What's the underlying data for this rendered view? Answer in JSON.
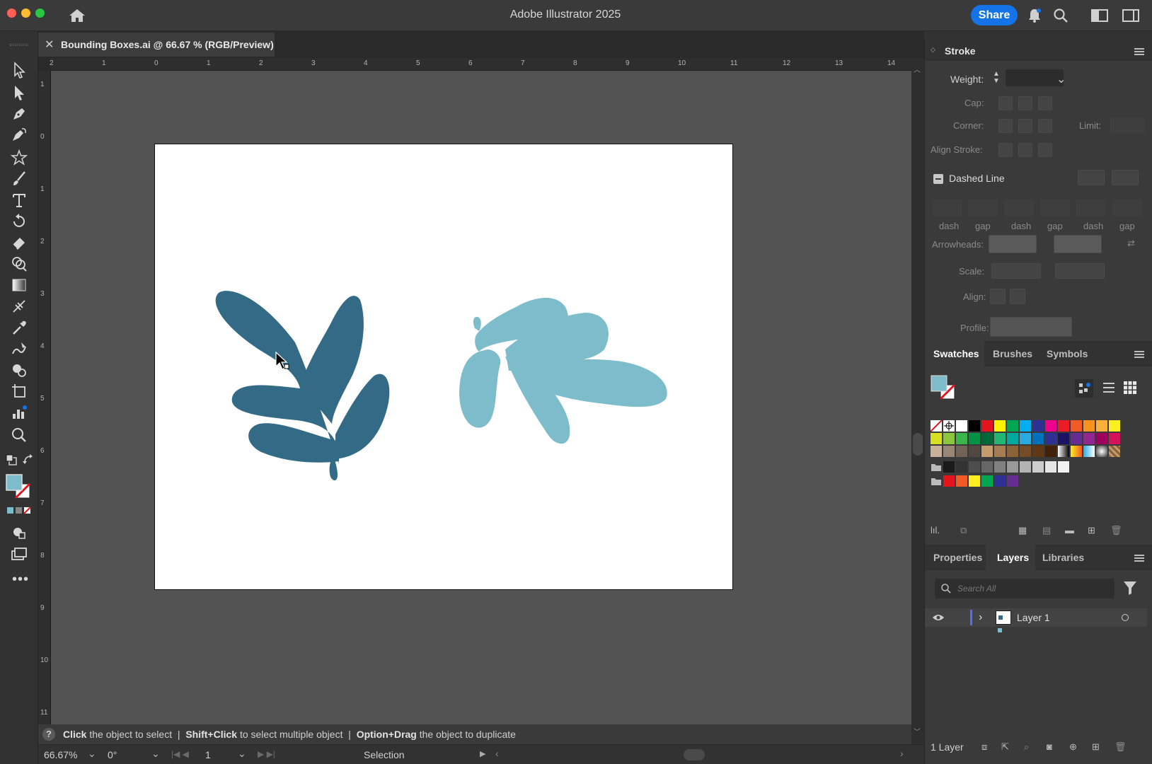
{
  "app": {
    "title": "Adobe Illustrator 2025",
    "share_label": "Share"
  },
  "document": {
    "tab_label": "Bounding Boxes.ai @ 66.67 % (RGB/Preview)"
  },
  "rulers": {
    "horizontal": [
      "2",
      "1",
      "0",
      "1",
      "2",
      "3",
      "4",
      "5",
      "6",
      "7",
      "8",
      "9",
      "10",
      "11",
      "12",
      "13",
      "14"
    ],
    "vertical": [
      "1",
      "0",
      "1",
      "2",
      "3",
      "4",
      "5",
      "6",
      "7",
      "8",
      "9",
      "10",
      "11"
    ]
  },
  "colors": {
    "shape_dark": "#336a85",
    "shape_light": "#7dbccb",
    "accent": "#1473e6",
    "fill_swatch": "#7dbccb"
  },
  "hint": {
    "part1_bold": "Click",
    "part1_text": "the object to select",
    "part2_bold": "Shift+Click",
    "part2_text": "to select multiple object",
    "part3_bold": "Option+Drag",
    "part3_text": "the object to duplicate"
  },
  "status": {
    "zoom": "66.67%",
    "rotation": "0°",
    "artboard": "1",
    "tool": "Selection"
  },
  "stroke_panel": {
    "title": "Stroke",
    "weight_label": "Weight:",
    "cap_label": "Cap:",
    "corner_label": "Corner:",
    "limit_label": "Limit:",
    "align_stroke_label": "Align Stroke:",
    "dashed_line_label": "Dashed Line",
    "dash_labels": [
      "dash",
      "gap",
      "dash",
      "gap",
      "dash",
      "gap"
    ],
    "arrowheads_label": "Arrowheads:",
    "scale_label": "Scale:",
    "align_label": "Align:",
    "profile_label": "Profile:"
  },
  "swatches_panel": {
    "tabs": [
      "Swatches",
      "Brushes",
      "Symbols"
    ],
    "rows": [
      [
        "none",
        "reg",
        "#ffffff",
        "#000000",
        "#e3141d",
        "#fef200",
        "#00a651",
        "#00aeef",
        "#2e3192",
        "#ec008c",
        "#ed1c24",
        "#f15a24",
        "#f7931e",
        "#fbb03b",
        "#fcee21"
      ],
      [
        "#d9e021",
        "#8cc63f",
        "#39b54a",
        "#009245",
        "#006837",
        "#22b573",
        "#00a99d",
        "#29abe2",
        "#0071bc",
        "#2e3192",
        "#1b1464",
        "#662d91",
        "#93278f",
        "#9e005d",
        "#d4145a"
      ],
      [
        "#c7b299",
        "#998675",
        "#736357",
        "#534741",
        "#c69c6d",
        "#a67c52",
        "#8c6239",
        "#754c24",
        "#603813",
        "#42210b",
        "grad1",
        "grad2",
        "grad3",
        "grad4",
        "pattern"
      ],
      [
        "folder",
        "#1a1a1a",
        "#333333",
        "#4d4d4d",
        "#666666",
        "#808080",
        "#999999",
        "#b3b3b3",
        "#cccccc",
        "#e6e6e6",
        "#f2f2f2"
      ],
      [
        "folder",
        "#e3141d",
        "#f15a24",
        "#fcee21",
        "#00a651",
        "#2e3192",
        "#662d91"
      ]
    ]
  },
  "layers_panel": {
    "tabs": [
      "Properties",
      "Layers",
      "Libraries"
    ],
    "search_placeholder": "Search All",
    "layer_name": "Layer 1",
    "footer_count": "1 Layer"
  }
}
